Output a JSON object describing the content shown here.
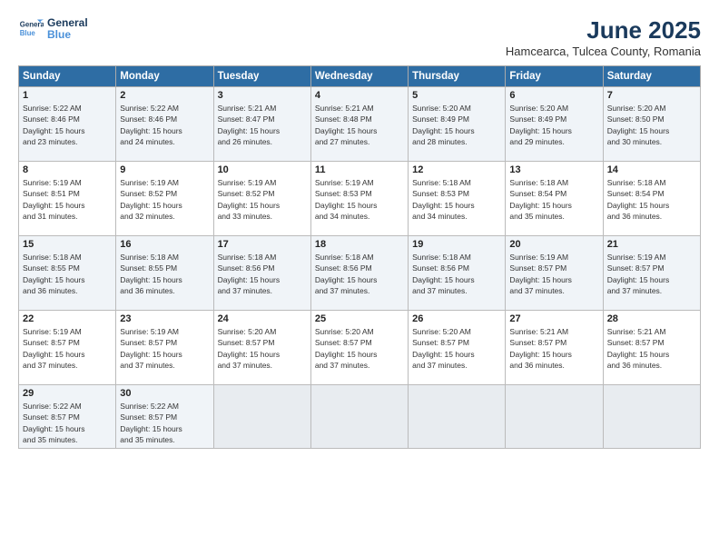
{
  "header": {
    "logo_line1": "General",
    "logo_line2": "Blue",
    "title": "June 2025",
    "subtitle": "Hamcearca, Tulcea County, Romania"
  },
  "days_of_week": [
    "Sunday",
    "Monday",
    "Tuesday",
    "Wednesday",
    "Thursday",
    "Friday",
    "Saturday"
  ],
  "weeks": [
    [
      {
        "day": "1",
        "info": "Sunrise: 5:22 AM\nSunset: 8:46 PM\nDaylight: 15 hours\nand 23 minutes."
      },
      {
        "day": "2",
        "info": "Sunrise: 5:22 AM\nSunset: 8:46 PM\nDaylight: 15 hours\nand 24 minutes."
      },
      {
        "day": "3",
        "info": "Sunrise: 5:21 AM\nSunset: 8:47 PM\nDaylight: 15 hours\nand 26 minutes."
      },
      {
        "day": "4",
        "info": "Sunrise: 5:21 AM\nSunset: 8:48 PM\nDaylight: 15 hours\nand 27 minutes."
      },
      {
        "day": "5",
        "info": "Sunrise: 5:20 AM\nSunset: 8:49 PM\nDaylight: 15 hours\nand 28 minutes."
      },
      {
        "day": "6",
        "info": "Sunrise: 5:20 AM\nSunset: 8:49 PM\nDaylight: 15 hours\nand 29 minutes."
      },
      {
        "day": "7",
        "info": "Sunrise: 5:20 AM\nSunset: 8:50 PM\nDaylight: 15 hours\nand 30 minutes."
      }
    ],
    [
      {
        "day": "8",
        "info": "Sunrise: 5:19 AM\nSunset: 8:51 PM\nDaylight: 15 hours\nand 31 minutes."
      },
      {
        "day": "9",
        "info": "Sunrise: 5:19 AM\nSunset: 8:52 PM\nDaylight: 15 hours\nand 32 minutes."
      },
      {
        "day": "10",
        "info": "Sunrise: 5:19 AM\nSunset: 8:52 PM\nDaylight: 15 hours\nand 33 minutes."
      },
      {
        "day": "11",
        "info": "Sunrise: 5:19 AM\nSunset: 8:53 PM\nDaylight: 15 hours\nand 34 minutes."
      },
      {
        "day": "12",
        "info": "Sunrise: 5:18 AM\nSunset: 8:53 PM\nDaylight: 15 hours\nand 34 minutes."
      },
      {
        "day": "13",
        "info": "Sunrise: 5:18 AM\nSunset: 8:54 PM\nDaylight: 15 hours\nand 35 minutes."
      },
      {
        "day": "14",
        "info": "Sunrise: 5:18 AM\nSunset: 8:54 PM\nDaylight: 15 hours\nand 36 minutes."
      }
    ],
    [
      {
        "day": "15",
        "info": "Sunrise: 5:18 AM\nSunset: 8:55 PM\nDaylight: 15 hours\nand 36 minutes."
      },
      {
        "day": "16",
        "info": "Sunrise: 5:18 AM\nSunset: 8:55 PM\nDaylight: 15 hours\nand 36 minutes."
      },
      {
        "day": "17",
        "info": "Sunrise: 5:18 AM\nSunset: 8:56 PM\nDaylight: 15 hours\nand 37 minutes."
      },
      {
        "day": "18",
        "info": "Sunrise: 5:18 AM\nSunset: 8:56 PM\nDaylight: 15 hours\nand 37 minutes."
      },
      {
        "day": "19",
        "info": "Sunrise: 5:18 AM\nSunset: 8:56 PM\nDaylight: 15 hours\nand 37 minutes."
      },
      {
        "day": "20",
        "info": "Sunrise: 5:19 AM\nSunset: 8:57 PM\nDaylight: 15 hours\nand 37 minutes."
      },
      {
        "day": "21",
        "info": "Sunrise: 5:19 AM\nSunset: 8:57 PM\nDaylight: 15 hours\nand 37 minutes."
      }
    ],
    [
      {
        "day": "22",
        "info": "Sunrise: 5:19 AM\nSunset: 8:57 PM\nDaylight: 15 hours\nand 37 minutes."
      },
      {
        "day": "23",
        "info": "Sunrise: 5:19 AM\nSunset: 8:57 PM\nDaylight: 15 hours\nand 37 minutes."
      },
      {
        "day": "24",
        "info": "Sunrise: 5:20 AM\nSunset: 8:57 PM\nDaylight: 15 hours\nand 37 minutes."
      },
      {
        "day": "25",
        "info": "Sunrise: 5:20 AM\nSunset: 8:57 PM\nDaylight: 15 hours\nand 37 minutes."
      },
      {
        "day": "26",
        "info": "Sunrise: 5:20 AM\nSunset: 8:57 PM\nDaylight: 15 hours\nand 37 minutes."
      },
      {
        "day": "27",
        "info": "Sunrise: 5:21 AM\nSunset: 8:57 PM\nDaylight: 15 hours\nand 36 minutes."
      },
      {
        "day": "28",
        "info": "Sunrise: 5:21 AM\nSunset: 8:57 PM\nDaylight: 15 hours\nand 36 minutes."
      }
    ],
    [
      {
        "day": "29",
        "info": "Sunrise: 5:22 AM\nSunset: 8:57 PM\nDaylight: 15 hours\nand 35 minutes."
      },
      {
        "day": "30",
        "info": "Sunrise: 5:22 AM\nSunset: 8:57 PM\nDaylight: 15 hours\nand 35 minutes."
      },
      {
        "day": "",
        "info": ""
      },
      {
        "day": "",
        "info": ""
      },
      {
        "day": "",
        "info": ""
      },
      {
        "day": "",
        "info": ""
      },
      {
        "day": "",
        "info": ""
      }
    ]
  ]
}
